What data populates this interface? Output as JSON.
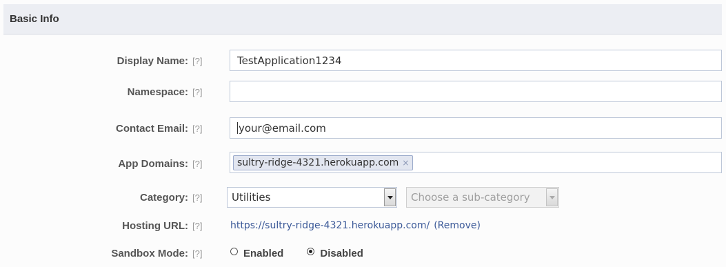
{
  "section": {
    "title": "Basic Info"
  },
  "help_text": "[?]",
  "fields": {
    "display_name": {
      "label": "Display Name:",
      "value": "TestApplication1234"
    },
    "namespace": {
      "label": "Namespace:",
      "value": ""
    },
    "contact_email": {
      "label": "Contact Email:",
      "value": "your@email.com"
    },
    "app_domains": {
      "label": "App Domains:",
      "token": "sultry-ridge-4321.herokuapp.com",
      "remove_glyph": "×"
    },
    "category": {
      "label": "Category:",
      "selected": "Utilities",
      "subcategory_placeholder": "Choose a sub-category"
    },
    "hosting_url": {
      "label": "Hosting URL:",
      "url": "https://sultry-ridge-4321.herokuapp.com/",
      "remove_link": "(Remove)"
    },
    "sandbox_mode": {
      "label": "Sandbox Mode:",
      "options": [
        {
          "label": "Enabled",
          "checked": false
        },
        {
          "label": "Disabled",
          "checked": true
        }
      ]
    }
  },
  "colors": {
    "link": "#3b5998",
    "header_bg": "#eceef3",
    "field_border": "#bdc7d8"
  }
}
